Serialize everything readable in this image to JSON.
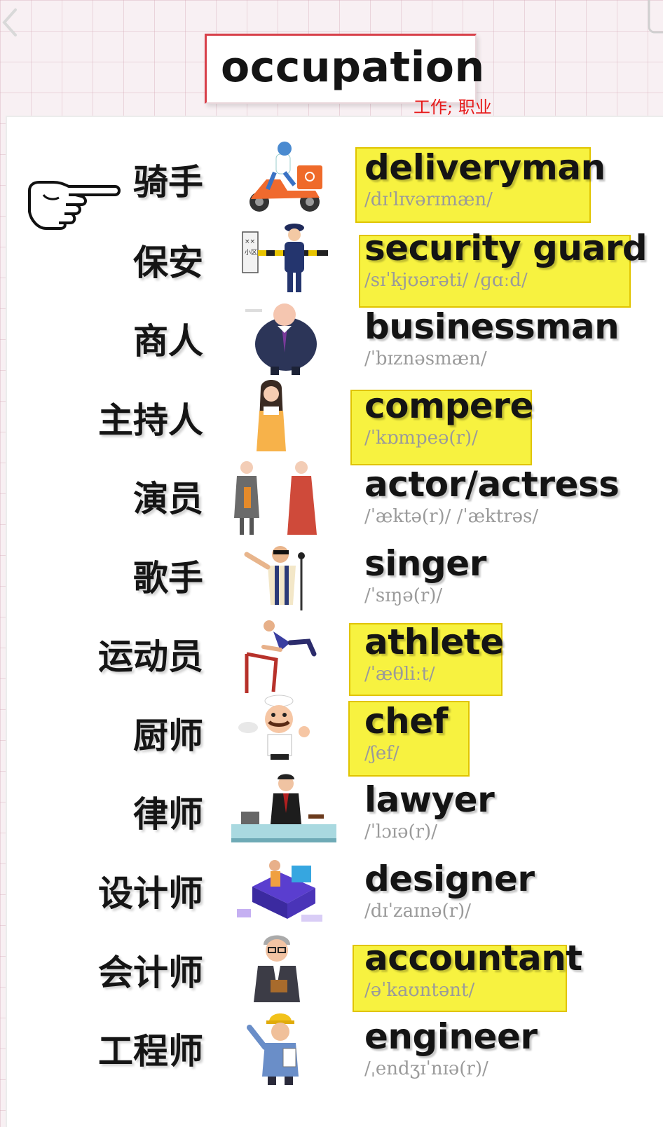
{
  "title": "occupation",
  "subtitle": "工作; 职业",
  "rows": [
    {
      "cn": "骑手",
      "en": "deliveryman",
      "ph": "/dɪ'lɪvərɪmæn/",
      "highlight": true,
      "icon": "delivery-scooter-icon"
    },
    {
      "cn": "保安",
      "en": "security guard",
      "ph": "/sɪˈkjʊərəti/     /ɡɑːd/",
      "highlight": true,
      "icon": "security-guard-icon"
    },
    {
      "cn": "商人",
      "en": "businessman",
      "ph": "/ˈbɪznəsmæn/",
      "highlight": false,
      "icon": "businessman-icon"
    },
    {
      "cn": "主持人",
      "en": "compere",
      "ph": "/ˈkɒmpeə(r)/",
      "highlight": true,
      "icon": "host-woman-icon"
    },
    {
      "cn": "演员",
      "en": "actor/actress",
      "ph": "/ˈæktə(r)/  /ˈæktrəs/",
      "highlight": false,
      "icon": "actors-icon"
    },
    {
      "cn": "歌手",
      "en": "singer",
      "ph": "/ˈsɪŋə(r)/",
      "highlight": false,
      "icon": "singer-icon"
    },
    {
      "cn": "运动员",
      "en": "athlete",
      "ph": "/ˈæθliːt/",
      "highlight": true,
      "icon": "hurdler-icon"
    },
    {
      "cn": "厨师",
      "en": "chef",
      "ph": "/ʃef/",
      "highlight": true,
      "icon": "chef-icon"
    },
    {
      "cn": "律师",
      "en": "lawyer",
      "ph": "/ˈlɔɪə(r)/",
      "highlight": false,
      "icon": "lawyer-desk-icon"
    },
    {
      "cn": "设计师",
      "en": "designer",
      "ph": "/dɪˈzaɪnə(r)/",
      "highlight": false,
      "icon": "designer-isometric-icon"
    },
    {
      "cn": "会计师",
      "en": "accountant",
      "ph": "/əˈkaʊntənt/",
      "highlight": true,
      "icon": "accountant-icon"
    },
    {
      "cn": "工程师",
      "en": "engineer",
      "ph": "/ˌendʒɪˈnɪə(r)/",
      "highlight": false,
      "icon": "engineer-icon"
    }
  ],
  "colors": {
    "highlight": "#f7f240",
    "highlight_border": "#e0c400",
    "title_accent": "#d8404a",
    "subtitle": "#e61a1a",
    "phonetic": "#9a9a9a",
    "text": "#141414"
  }
}
